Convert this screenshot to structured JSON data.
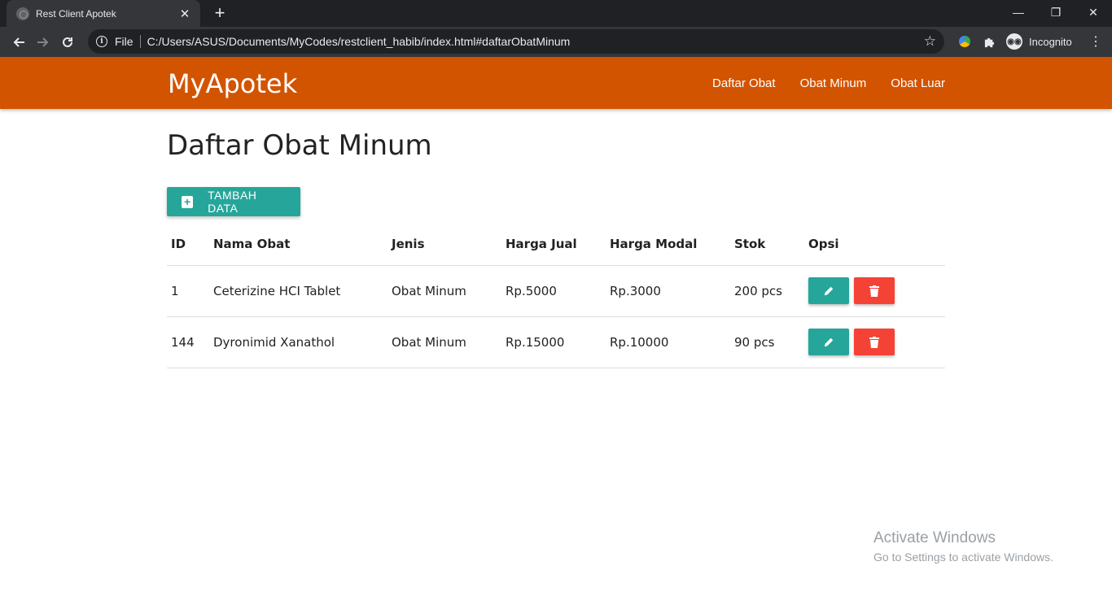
{
  "browser": {
    "tab_title": "Rest Client Apotek",
    "tab_close": "✕",
    "new_tab": "+",
    "scheme_label": "File",
    "url": "C:/Users/ASUS/Documents/MyCodes/restclient_habib/index.html#daftarObatMinum",
    "incognito_label": "Incognito",
    "window_controls": [
      "—",
      "❐",
      "✕"
    ]
  },
  "navbar": {
    "brand": "MyApotek",
    "links": [
      "Daftar Obat",
      "Obat Minum",
      "Obat Luar"
    ],
    "color": "#d35400"
  },
  "main": {
    "title": "Daftar Obat Minum",
    "add_button": "TAMBAH DATA",
    "table": {
      "headers": [
        "ID",
        "Nama Obat",
        "Jenis",
        "Harga Jual",
        "Harga Modal",
        "Stok",
        "Opsi"
      ],
      "rows": [
        [
          "1",
          "Ceterizine HCI Tablet",
          "Obat Minum",
          "Rp.5000",
          "Rp.3000",
          "200 pcs"
        ],
        [
          "144",
          "Dyronimid Xanathol",
          "Obat Minum",
          "Rp.15000",
          "Rp.10000",
          "90 pcs"
        ]
      ]
    },
    "accent_color": "#26a69a",
    "danger_color": "#f44336"
  },
  "watermark": {
    "title": "Activate Windows",
    "subtitle": "Go to Settings to activate Windows."
  }
}
